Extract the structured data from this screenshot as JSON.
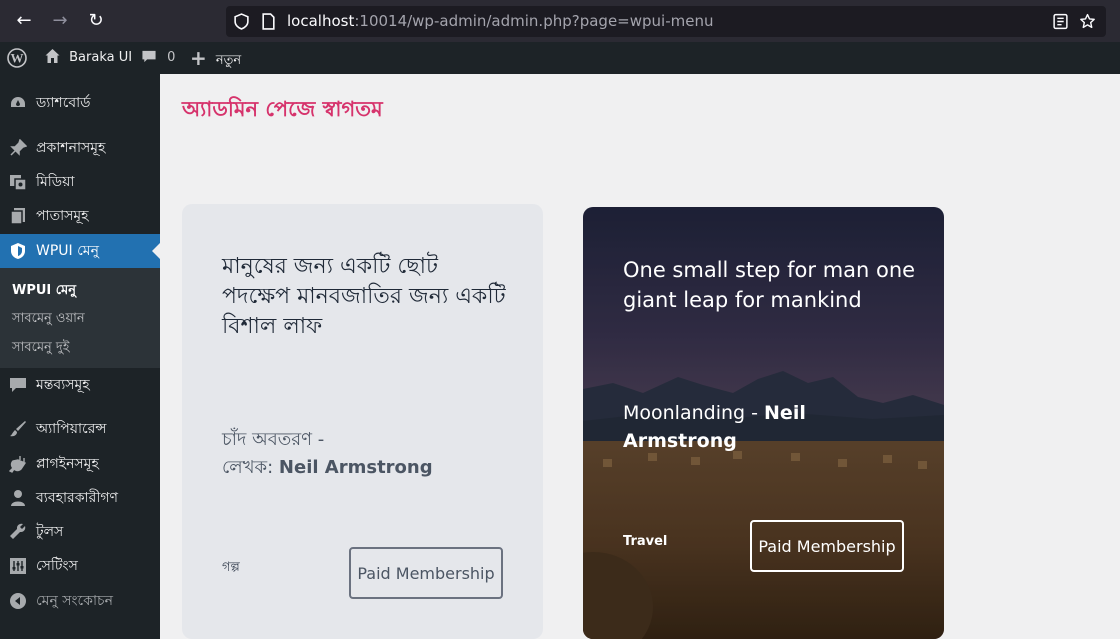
{
  "browser": {
    "url_host": "localhost",
    "url_rest": ":10014/wp-admin/admin.php?page=wpui-menu"
  },
  "admin_bar": {
    "site_name": "Baraka UI",
    "comments_count": "0",
    "new_label": "নতুন"
  },
  "sidebar": {
    "items": [
      {
        "label": "ড্যাশবোর্ড",
        "icon": "dashboard-icon"
      },
      {
        "label": "প্রকাশনাসমূহ",
        "icon": "pushpin-icon"
      },
      {
        "label": "মিডিয়া",
        "icon": "media-icon"
      },
      {
        "label": "পাতাসমূহ",
        "icon": "pages-icon"
      },
      {
        "label": "WPUI মেনু",
        "icon": "shield-icon"
      },
      {
        "label": "মন্তব্যসমূহ",
        "icon": "comment-icon"
      },
      {
        "label": "অ্যাপিয়ারেন্স",
        "icon": "brush-icon"
      },
      {
        "label": "প্লাগইনসমূহ",
        "icon": "plugin-icon"
      },
      {
        "label": "ব্যবহারকারীগণ",
        "icon": "users-icon"
      },
      {
        "label": "টুলস",
        "icon": "wrench-icon"
      },
      {
        "label": "সেটিংস",
        "icon": "settings-icon"
      },
      {
        "label": "মেনু সংকোচন",
        "icon": "collapse-icon"
      }
    ],
    "submenu": [
      "WPUI মেনু",
      "সাবমেনু ওয়ান",
      "সাবমেনু দুই"
    ]
  },
  "main": {
    "title": "অ্যাডমিন পেজে স্বাগতম",
    "card_light": {
      "quote": "মানুষের জন্য একটি ছোট পদক্ষেপ মানবজাতির জন্য একটি বিশাল লাফ",
      "source_line": "চাঁদ অবতরণ -",
      "author_prefix": "লেখক: ",
      "author": "Neil Armstrong",
      "tag": "গল্প",
      "button": "Paid Membership"
    },
    "card_dark": {
      "quote": "One small step for man one giant leap for mankind",
      "source": "Moonlanding - ",
      "author": "Neil Armstrong",
      "tag": "Travel",
      "button": "Paid Membership"
    }
  },
  "colors": {
    "accent": "#2271b1",
    "title": "#d6336c",
    "admin_bg": "#1d2327"
  }
}
